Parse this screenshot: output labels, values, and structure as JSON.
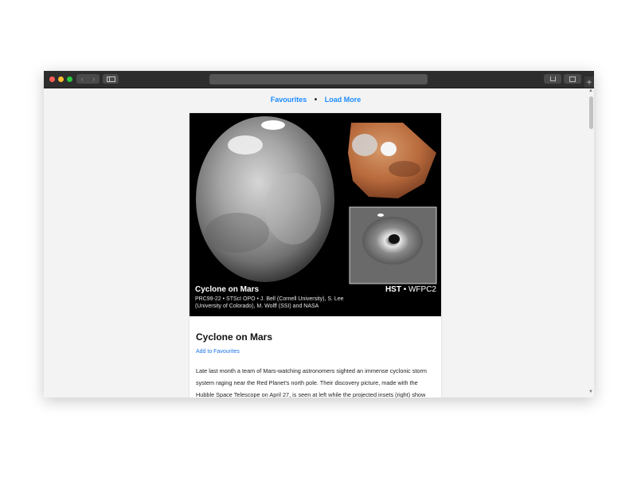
{
  "browser": {
    "nav_back": "‹",
    "nav_forward": "›",
    "new_tab": "+"
  },
  "topnav": {
    "favourites": "Favourites",
    "separator": "•",
    "load_more": "Load More"
  },
  "article": {
    "image_caption": {
      "title": "Cyclone on Mars",
      "credit": "PRC99-22 • STScI OPO • J. Bell (Cornell University), S. Lee (University of Colorado), M. Wolff (SSI) and NASA",
      "instrument_bold": "HST",
      "instrument_rest": "• WFPC2"
    },
    "title": "Cyclone on Mars",
    "add_to_favourites": "Add to Favourites",
    "description": "Late last month a team of Mars-watching astronomers sighted an immense cyclonic storm system raging near the Red Planet's north pole. Their discovery picture, made with the Hubble Space Telescope on April 27, is seen at left while the projected insets (right) show"
  },
  "colors": {
    "link": "#1a8cff",
    "titlebar": "#2d2d2d",
    "page_bg": "#f3f3f3"
  },
  "icons": [
    "traffic-light-close",
    "traffic-light-minimize",
    "traffic-light-zoom",
    "sidebar-icon",
    "share-icon",
    "tabs-icon"
  ]
}
